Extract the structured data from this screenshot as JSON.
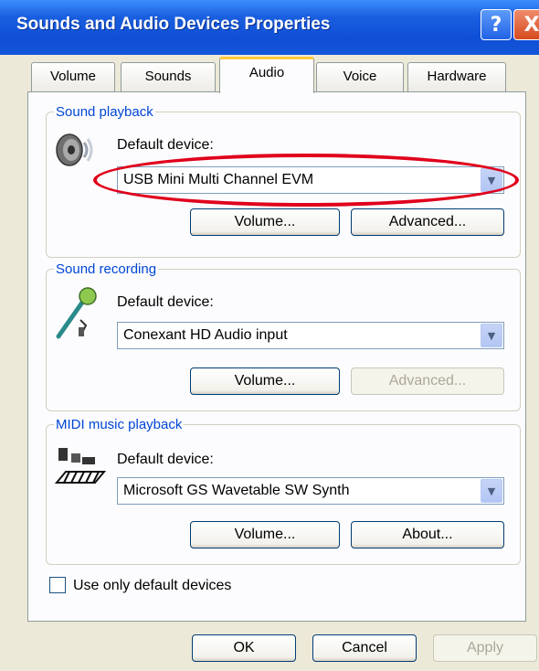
{
  "window": {
    "title": "Sounds and Audio Devices Properties",
    "help_glyph": "?",
    "close_glyph": "X"
  },
  "tabs": [
    "Volume",
    "Sounds",
    "Audio",
    "Voice",
    "Hardware"
  ],
  "active_tab": "Audio",
  "sound_playback": {
    "legend": "Sound playback",
    "label": "Default device:",
    "device": "USB Mini Multi Channel EVM",
    "volume_button": "Volume...",
    "advanced_button": "Advanced..."
  },
  "sound_recording": {
    "legend": "Sound recording",
    "label": "Default device:",
    "device": "Conexant HD Audio input",
    "volume_button": "Volume...",
    "advanced_button": "Advanced..."
  },
  "midi_playback": {
    "legend": "MIDI music playback",
    "label": "Default device:",
    "device": "Microsoft GS Wavetable SW Synth",
    "volume_button": "Volume...",
    "about_button": "About..."
  },
  "checkbox": {
    "label": "Use only default devices",
    "checked": false
  },
  "footer": {
    "ok": "OK",
    "cancel": "Cancel",
    "apply": "Apply"
  },
  "colors": {
    "titlebar": "#0f4fd6",
    "highlight_ellipse": "#e0001b",
    "legend_text": "#0046d5"
  }
}
